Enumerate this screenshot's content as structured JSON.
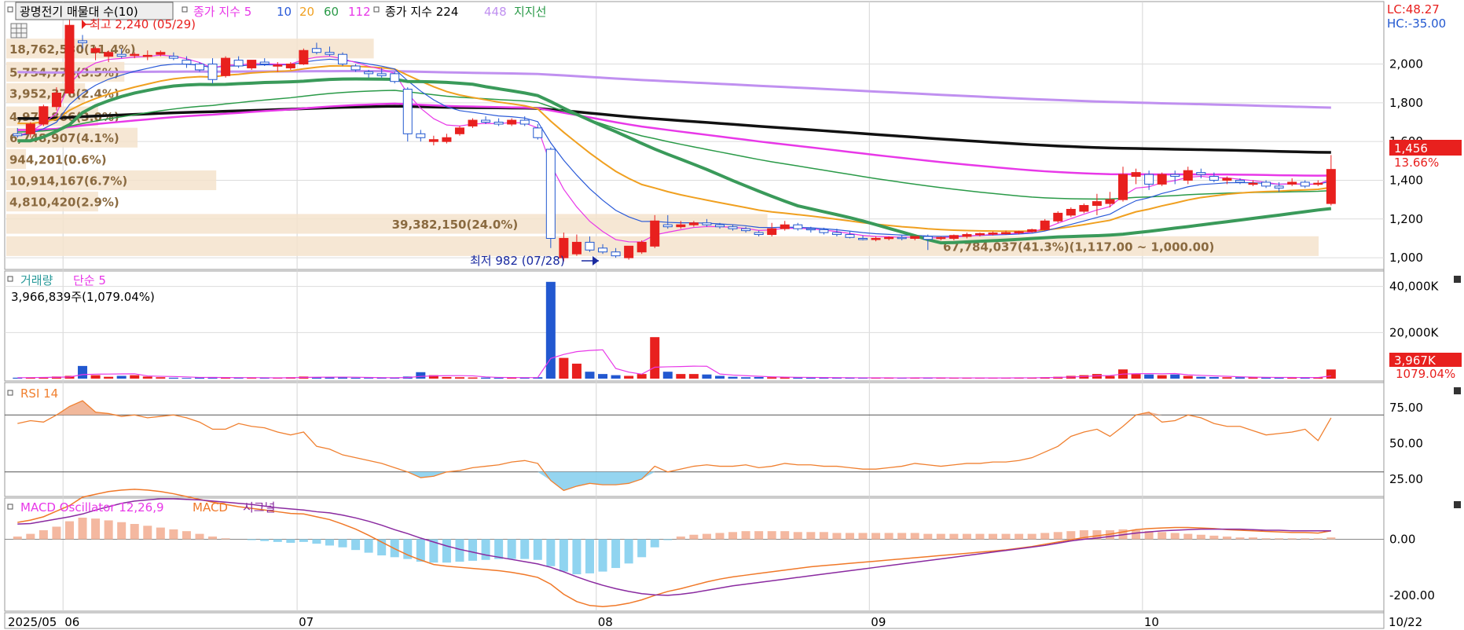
{
  "colors": {
    "up": "#e8201e",
    "down": "#2258d0",
    "ma5": "#e838e8",
    "ma10": "#2a5ad8",
    "ma20": "#f0a020",
    "ma60": "#2a9a48",
    "ma112": "#e838e8",
    "ma224": "#111111",
    "ma448": "#c090f0",
    "support": "#3a9a5a",
    "rsi": "#f08030",
    "macd": "#f07828",
    "signal": "#8a2aa0"
  },
  "legend": {
    "title": "광명전기 매물대 수(10)",
    "ma_prefix": "종가 지수 5",
    "ma10": "10",
    "ma20": "20",
    "ma60": "60",
    "ma112": "112",
    "ma224": "종가 지수 224",
    "ma448": "448",
    "support": "지지선"
  },
  "right_info": {
    "lc": "LC:48.27",
    "hc": "HC:-35.00"
  },
  "price_tag": {
    "price": "1,456",
    "pct": "13.66%"
  },
  "annotations": {
    "high": "최고 2,240 (05/29)",
    "low": "최저 982 (07/28)"
  },
  "volume_profile": [
    {
      "label": "18,762,530(11.4%)",
      "price": 2080,
      "len": 0.28
    },
    {
      "label": "5,754,774(3.5%)",
      "price": 1960,
      "len": 0.09
    },
    {
      "label": "3,952,376(2.4%)",
      "price": 1850,
      "len": 0.06
    },
    {
      "label": "4,973,866(3.0%)",
      "price": 1730,
      "len": 0.07
    },
    {
      "label": "6,748,907(4.1%)",
      "price": 1620,
      "len": 0.1
    },
    {
      "label": "944,201(0.6%)",
      "price": 1510,
      "len": 0.015
    },
    {
      "label": "10,914,167(6.7%)",
      "price": 1400,
      "len": 0.16
    },
    {
      "label": "4,810,420(2.9%)",
      "price": 1290,
      "len": 0.07
    },
    {
      "label": "39,382,150(24.0%)",
      "price": 1175,
      "len": 0.58
    },
    {
      "label": "67,784,037(41.3%)(1,117.00 ~ 1,000.00)",
      "price": 1060,
      "len": 1.0
    }
  ],
  "volume_legend": {
    "title": "거래량",
    "ma": "단순 5",
    "value": "3,966,839주(1,079.04%)",
    "tag": "3,967K",
    "tag_pct": "1079.04%"
  },
  "rsi_legend": {
    "title": "RSI 14"
  },
  "macd_legend": {
    "title": "MACD Oscillator 12,26,9",
    "macd": "MACD",
    "signal": "시그널"
  },
  "chart_data": {
    "type": "candlestick",
    "price_axis": {
      "ticks": [
        {
          "v": 2000,
          "label": "2,000"
        },
        {
          "v": 1800,
          "label": "1,800"
        },
        {
          "v": 1600,
          "label": "1,600"
        },
        {
          "v": 1400,
          "label": "1,400"
        },
        {
          "v": 1200,
          "label": "1,200"
        },
        {
          "v": 1000,
          "label": "1,000"
        }
      ],
      "range": [
        960,
        2290
      ]
    },
    "volume_axis": {
      "ticks": [
        {
          "v": 40000,
          "label": "40,000K"
        },
        {
          "v": 20000,
          "label": "20,000K"
        }
      ],
      "range": [
        0,
        45000
      ]
    },
    "rsi_axis": {
      "ticks": [
        {
          "v": 75,
          "label": "75.00"
        },
        {
          "v": 50,
          "label": "50.00"
        },
        {
          "v": 25,
          "label": "25.00"
        }
      ],
      "range": [
        15,
        90
      ],
      "upper": 70,
      "lower": 30
    },
    "macd_axis": {
      "ticks": [
        {
          "v": 0,
          "label": "0.00"
        },
        {
          "v": -200,
          "label": "-200.00"
        }
      ],
      "range": [
        -245,
        130
      ]
    },
    "date_labels": [
      {
        "i": 0,
        "label": "2025/05"
      },
      {
        "i": 4,
        "label": "06"
      },
      {
        "i": 22,
        "label": "07"
      },
      {
        "i": 45,
        "label": "08"
      },
      {
        "i": 66,
        "label": "09"
      },
      {
        "i": 87,
        "label": "10"
      },
      {
        "i": 102,
        "label": "10/22"
      }
    ],
    "candles": [
      [
        1640,
        1670,
        1620,
        1630
      ],
      [
        1640,
        1700,
        1620,
        1690
      ],
      [
        1690,
        1790,
        1680,
        1780
      ],
      [
        1780,
        1880,
        1760,
        1850
      ],
      [
        1850,
        2240,
        1840,
        2200
      ],
      [
        2120,
        2150,
        2080,
        2110
      ],
      [
        2060,
        2090,
        2020,
        2080
      ],
      [
        2040,
        2070,
        2010,
        2060
      ],
      [
        2050,
        2080,
        2030,
        2040
      ],
      [
        2045,
        2060,
        2030,
        2050
      ],
      [
        2040,
        2070,
        2020,
        2045
      ],
      [
        2050,
        2070,
        2040,
        2060
      ],
      [
        2040,
        2060,
        2020,
        2030
      ],
      [
        2020,
        2040,
        1980,
        2000
      ],
      [
        2000,
        2010,
        1960,
        1970
      ],
      [
        2000,
        2030,
        1900,
        1920
      ],
      [
        1940,
        2040,
        1930,
        2030
      ],
      [
        2020,
        2040,
        1980,
        1990
      ],
      [
        1980,
        2020,
        1970,
        2020
      ],
      [
        2010,
        2030,
        1990,
        2000
      ],
      [
        1990,
        2010,
        1960,
        1995
      ],
      [
        1980,
        2010,
        1970,
        2000
      ],
      [
        2000,
        2080,
        1995,
        2070
      ],
      [
        2080,
        2110,
        2050,
        2060
      ],
      [
        2060,
        2090,
        2040,
        2050
      ],
      [
        2050,
        2060,
        1990,
        2000
      ],
      [
        1990,
        2000,
        1960,
        1970
      ],
      [
        1960,
        1970,
        1930,
        1950
      ],
      [
        1950,
        1980,
        1930,
        1940
      ],
      [
        1950,
        1960,
        1900,
        1910
      ],
      [
        1870,
        1880,
        1600,
        1640
      ],
      [
        1640,
        1660,
        1600,
        1620
      ],
      [
        1600,
        1630,
        1580,
        1610
      ],
      [
        1600,
        1640,
        1590,
        1620
      ],
      [
        1640,
        1680,
        1630,
        1670
      ],
      [
        1680,
        1720,
        1670,
        1710
      ],
      [
        1710,
        1730,
        1690,
        1700
      ],
      [
        1700,
        1720,
        1680,
        1690
      ],
      [
        1690,
        1720,
        1680,
        1710
      ],
      [
        1710,
        1730,
        1680,
        1690
      ],
      [
        1670,
        1690,
        1610,
        1620
      ],
      [
        1560,
        1570,
        1050,
        1100
      ],
      [
        1000,
        1130,
        982,
        1100
      ],
      [
        1020,
        1120,
        1010,
        1080
      ],
      [
        1080,
        1110,
        1030,
        1040
      ],
      [
        1050,
        1070,
        1020,
        1030
      ],
      [
        1030,
        1050,
        1000,
        1010
      ],
      [
        1000,
        1060,
        990,
        1060
      ],
      [
        1030,
        1090,
        1020,
        1080
      ],
      [
        1060,
        1220,
        1050,
        1190
      ],
      [
        1170,
        1220,
        1150,
        1160
      ],
      [
        1160,
        1190,
        1150,
        1170
      ],
      [
        1170,
        1190,
        1160,
        1180
      ],
      [
        1180,
        1200,
        1160,
        1170
      ],
      [
        1170,
        1180,
        1150,
        1160
      ],
      [
        1160,
        1170,
        1140,
        1150
      ],
      [
        1150,
        1160,
        1130,
        1140
      ],
      [
        1130,
        1140,
        1110,
        1120
      ],
      [
        1120,
        1180,
        1110,
        1150
      ],
      [
        1150,
        1190,
        1140,
        1170
      ],
      [
        1170,
        1180,
        1140,
        1150
      ],
      [
        1150,
        1160,
        1130,
        1145
      ],
      [
        1145,
        1155,
        1120,
        1130
      ],
      [
        1130,
        1150,
        1110,
        1120
      ],
      [
        1120,
        1135,
        1100,
        1105
      ],
      [
        1100,
        1115,
        1090,
        1095
      ],
      [
        1095,
        1110,
        1085,
        1100
      ],
      [
        1100,
        1110,
        1090,
        1105
      ],
      [
        1105,
        1115,
        1090,
        1100
      ],
      [
        1100,
        1110,
        1090,
        1110
      ],
      [
        1110,
        1120,
        1040,
        1095
      ],
      [
        1100,
        1110,
        1090,
        1105
      ],
      [
        1100,
        1120,
        1090,
        1115
      ],
      [
        1110,
        1130,
        1100,
        1120
      ],
      [
        1120,
        1130,
        1110,
        1125
      ],
      [
        1125,
        1135,
        1115,
        1128
      ],
      [
        1128,
        1140,
        1120,
        1130
      ],
      [
        1130,
        1140,
        1120,
        1135
      ],
      [
        1135,
        1150,
        1130,
        1145
      ],
      [
        1145,
        1200,
        1140,
        1190
      ],
      [
        1190,
        1240,
        1180,
        1230
      ],
      [
        1220,
        1260,
        1210,
        1250
      ],
      [
        1240,
        1280,
        1230,
        1270
      ],
      [
        1270,
        1330,
        1220,
        1290
      ],
      [
        1280,
        1340,
        1260,
        1300
      ],
      [
        1300,
        1470,
        1290,
        1430
      ],
      [
        1420,
        1460,
        1380,
        1440
      ],
      [
        1430,
        1450,
        1350,
        1380
      ],
      [
        1380,
        1440,
        1370,
        1430
      ],
      [
        1430,
        1450,
        1380,
        1420
      ],
      [
        1400,
        1470,
        1380,
        1450
      ],
      [
        1440,
        1460,
        1410,
        1430
      ],
      [
        1420,
        1440,
        1390,
        1400
      ],
      [
        1400,
        1420,
        1380,
        1410
      ],
      [
        1400,
        1410,
        1380,
        1390
      ],
      [
        1380,
        1400,
        1370,
        1385
      ],
      [
        1390,
        1400,
        1360,
        1370
      ],
      [
        1370,
        1390,
        1340,
        1360
      ],
      [
        1380,
        1410,
        1370,
        1390
      ],
      [
        1390,
        1400,
        1360,
        1370
      ],
      [
        1380,
        1400,
        1370,
        1385
      ],
      [
        1280,
        1530,
        1270,
        1456
      ]
    ],
    "volume": [
      400,
      500,
      600,
      900,
      1200,
      5500,
      1500,
      800,
      1200,
      1500,
      900,
      600,
      400,
      300,
      500,
      700,
      400,
      300,
      300,
      350,
      400,
      600,
      900,
      700,
      600,
      500,
      400,
      300,
      350,
      450,
      900,
      2800,
      1500,
      700,
      600,
      500,
      450,
      400,
      400,
      500,
      600,
      42000,
      9000,
      6500,
      3000,
      2000,
      1500,
      1200,
      2000,
      18000,
      3000,
      2000,
      2000,
      1800,
      1200,
      800,
      600,
      700,
      600,
      500,
      500,
      400,
      400,
      350,
      350,
      300,
      300,
      350,
      300,
      400,
      300,
      300,
      300,
      300,
      350,
      300,
      300,
      400,
      500,
      600,
      800,
      1200,
      1500,
      2000,
      1200,
      4000,
      2000,
      1800,
      1500,
      1800,
      1200,
      800,
      700,
      600,
      600,
      500,
      500,
      500,
      450,
      450,
      500,
      3967
    ],
    "rsi": [
      64,
      66,
      65,
      70,
      76,
      80,
      72,
      71,
      69,
      70,
      68,
      69,
      70,
      68,
      65,
      60,
      60,
      64,
      62,
      61,
      58,
      56,
      58,
      48,
      46,
      42,
      40,
      38,
      36,
      33,
      30,
      26,
      27,
      30,
      31,
      33,
      34,
      35,
      37,
      38,
      36,
      24,
      17,
      20,
      22,
      21,
      21,
      22,
      25,
      34,
      30,
      32,
      34,
      35,
      34,
      34,
      35,
      33,
      34,
      36,
      35,
      35,
      34,
      34,
      33,
      32,
      32,
      33,
      34,
      36,
      35,
      34,
      35,
      36,
      36,
      37,
      37,
      38,
      40,
      44,
      48,
      55,
      58,
      60,
      55,
      62,
      70,
      72,
      65,
      66,
      70,
      68,
      64,
      62,
      62,
      59,
      56,
      57,
      58,
      60,
      52,
      68
    ],
    "macd_osc": [
      6,
      12,
      20,
      28,
      40,
      48,
      46,
      42,
      38,
      34,
      30,
      26,
      22,
      18,
      12,
      6,
      2,
      0,
      -2,
      -4,
      -6,
      -8,
      -6,
      -10,
      -14,
      -18,
      -24,
      -30,
      -36,
      -40,
      -44,
      -50,
      -52,
      -52,
      -50,
      -48,
      -46,
      -44,
      -44,
      -44,
      -46,
      -60,
      -72,
      -78,
      -76,
      -72,
      -64,
      -54,
      -40,
      -18,
      -2,
      6,
      10,
      12,
      14,
      16,
      18,
      18,
      18,
      18,
      16,
      16,
      16,
      14,
      14,
      14,
      14,
      14,
      14,
      14,
      12,
      12,
      12,
      12,
      12,
      12,
      12,
      12,
      12,
      14,
      16,
      18,
      20,
      20,
      20,
      22,
      20,
      18,
      16,
      14,
      12,
      10,
      8,
      6,
      4,
      4,
      2,
      2,
      2,
      2,
      2,
      4
    ],
    "macd": [
      60,
      68,
      80,
      100,
      120,
      150,
      160,
      170,
      175,
      178,
      175,
      170,
      162,
      152,
      142,
      132,
      124,
      116,
      110,
      104,
      98,
      92,
      90,
      80,
      70,
      54,
      36,
      14,
      -10,
      -34,
      -56,
      -74,
      -90,
      -96,
      -100,
      -104,
      -108,
      -112,
      -118,
      -126,
      -136,
      -160,
      -196,
      -222,
      -236,
      -240,
      -236,
      -228,
      -216,
      -200,
      -186,
      -176,
      -164,
      -152,
      -142,
      -134,
      -128,
      -122,
      -116,
      -110,
      -104,
      -98,
      -94,
      -90,
      -86,
      -82,
      -78,
      -74,
      -70,
      -66,
      -62,
      -58,
      -54,
      -50,
      -46,
      -42,
      -38,
      -32,
      -26,
      -18,
      -10,
      -2,
      6,
      12,
      18,
      26,
      34,
      38,
      40,
      42,
      42,
      40,
      38,
      34,
      32,
      30,
      28,
      26,
      24,
      24,
      22,
      30
    ],
    "signal": [
      54,
      56,
      64,
      72,
      80,
      90,
      104,
      116,
      128,
      136,
      140,
      144,
      144,
      142,
      140,
      136,
      132,
      128,
      124,
      118,
      112,
      108,
      104,
      98,
      94,
      86,
      76,
      64,
      50,
      34,
      20,
      4,
      -10,
      -24,
      -36,
      -46,
      -56,
      -64,
      -72,
      -80,
      -88,
      -100,
      -116,
      -134,
      -150,
      -164,
      -176,
      -186,
      -194,
      -198,
      -200,
      -196,
      -190,
      -182,
      -174,
      -166,
      -160,
      -154,
      -148,
      -142,
      -136,
      -130,
      -124,
      -118,
      -112,
      -106,
      -100,
      -94,
      -88,
      -82,
      -76,
      -70,
      -64,
      -58,
      -52,
      -46,
      -40,
      -34,
      -28,
      -22,
      -14,
      -6,
      0,
      4,
      10,
      16,
      22,
      26,
      30,
      32,
      34,
      36,
      36,
      36,
      36,
      34,
      32,
      32,
      30,
      30,
      30,
      30
    ]
  }
}
